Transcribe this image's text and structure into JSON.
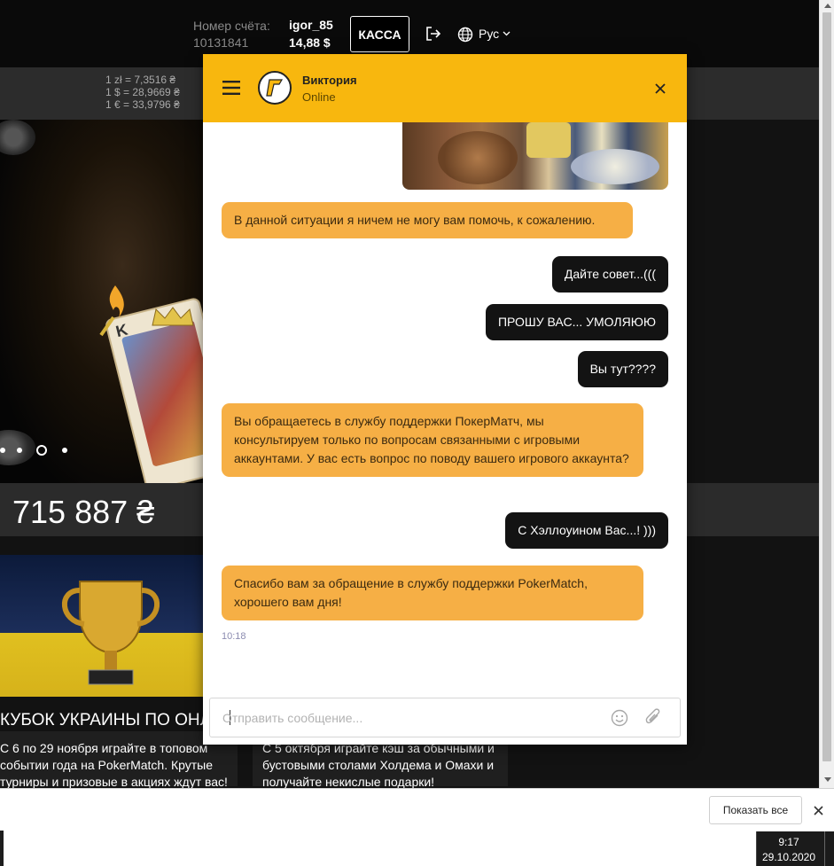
{
  "header": {
    "account_label": "Номер счёта:",
    "account_number": "10131841",
    "username": "igor_85",
    "balance": "14,88 $",
    "kassa_label": "КАССА",
    "language": "Рус"
  },
  "rates": [
    "1 zł = 7,3516 ₴",
    "1 $ = 28,9669 ₴",
    "1 € = 33,9796 ₴"
  ],
  "banner": {
    "card_letter": "K"
  },
  "jackpot": "715 887 ₴",
  "promos": [
    {
      "title": "КУБОК УКРАИНЫ ПО ОНЛ",
      "lines": [
        "С 6 по 29 ноября играйте в топовом",
        "событии года на PokerMatch. Крутые",
        "турниры и призовые в акциях ждут вас!"
      ]
    },
    {
      "lines": [
        "С 5 октября играйте кэш за обычными и",
        "бустовыми столами Холдема и Омахи и",
        "получайте некислые подарки!"
      ]
    }
  ],
  "chat": {
    "agent_name": "Виктория",
    "agent_status": "Online",
    "messages": [
      {
        "from": "agent",
        "text": "В данной ситуации я ничем не могу вам помочь, к сожалению."
      },
      {
        "from": "user",
        "text": "Дайте совет...((("
      },
      {
        "from": "user",
        "text": "ПРОШУ ВАС... УМОЛЯЮЮ"
      },
      {
        "from": "user",
        "text": "Вы тут????"
      },
      {
        "from": "agent",
        "text": "Вы обращаетесь в службу поддержки ПокерМатч, мы консультируем только по вопросам связанными с игровыми аккаунтами. У вас есть вопрос по поводу вашего игрового аккаунта?"
      },
      {
        "from": "user",
        "text": "С Хэллоуином Вас...! )))"
      },
      {
        "from": "agent",
        "text": "Спасибо вам за обращение в службу поддержки PokerMatch, хорошего вам дня!"
      }
    ],
    "last_time": "10:18",
    "input_placeholder": "Отправить сообщение..."
  },
  "downloads": {
    "show_all": "Показать все"
  },
  "taskbar": {
    "time": "9:17",
    "date": "29.10.2020"
  },
  "colors": {
    "chat_header": "#f8b70e",
    "agent_bubble": "#f6af45",
    "user_bubble": "#131313"
  }
}
